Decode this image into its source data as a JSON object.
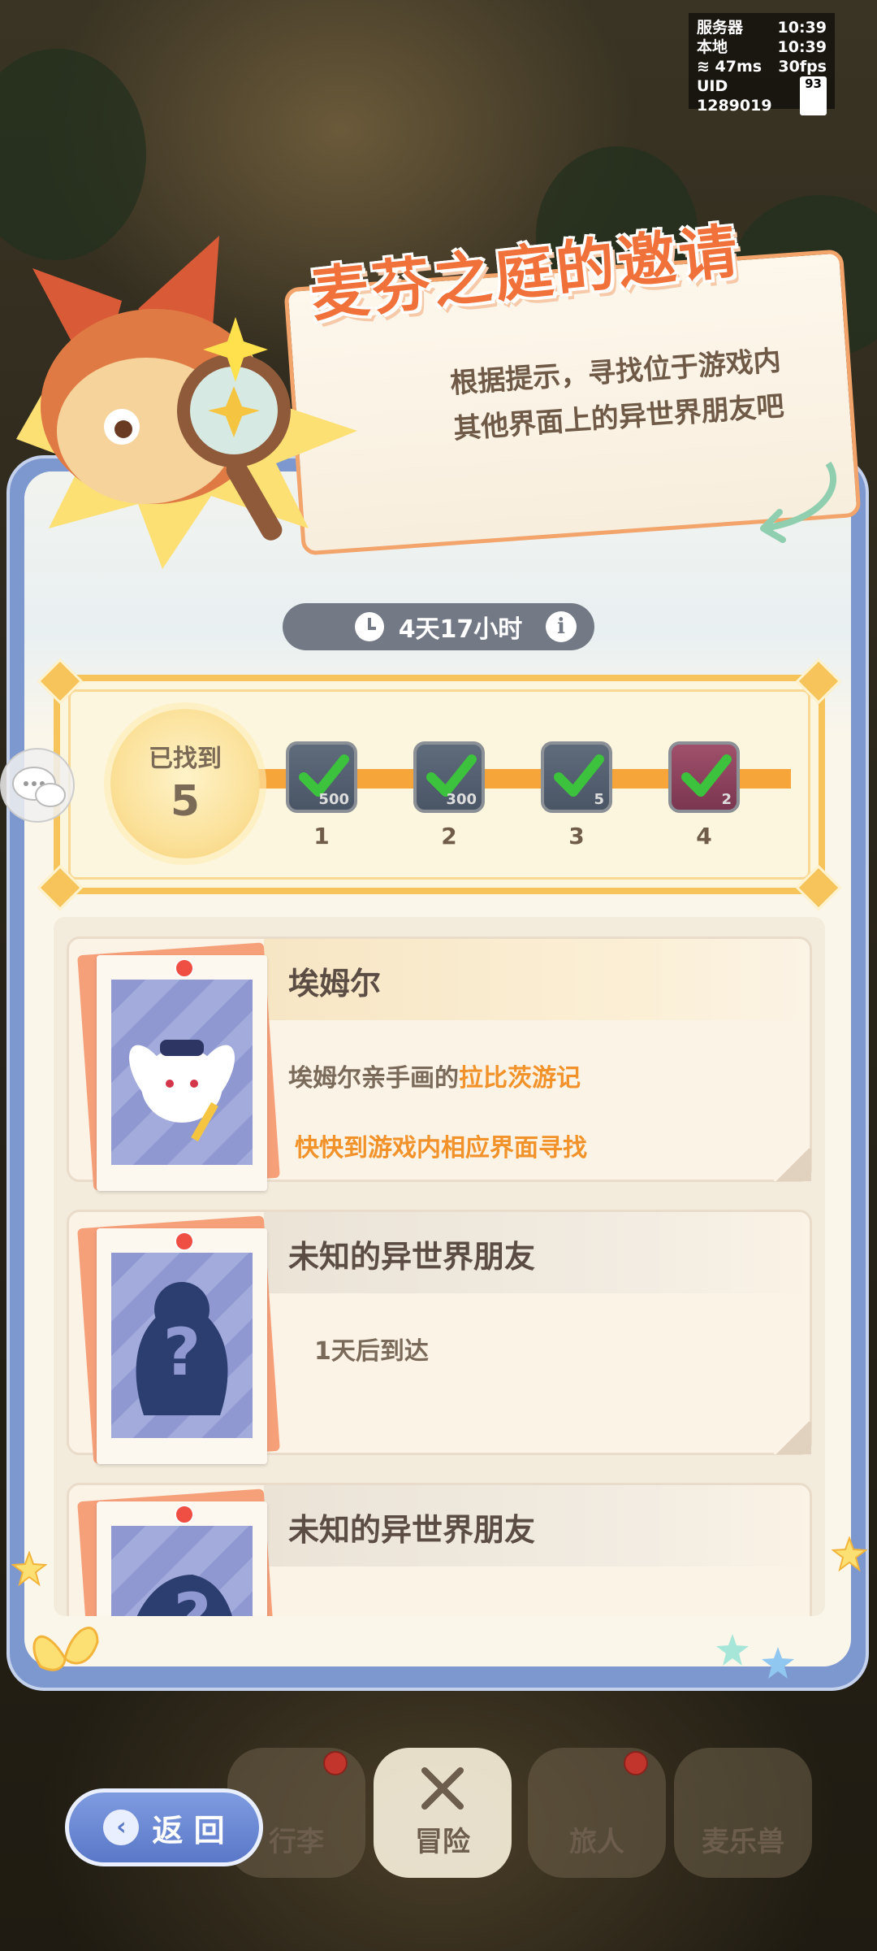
{
  "status": {
    "server_label": "服务器",
    "server_time": "10:39",
    "local_label": "本地",
    "local_time": "10:39",
    "ping": "47ms",
    "fps": "30fps",
    "uid": "UID 1289019",
    "battery": "93"
  },
  "event": {
    "title": "麦芬之庭的邀请",
    "subtitle_line1": "根据提示，寻找位于游戏内",
    "subtitle_line2": "其他界面上的异世界朋友吧",
    "timer": "4天17小时"
  },
  "progress": {
    "found_label": "已找到",
    "found_count": "5",
    "rewards": [
      {
        "step": "1",
        "qty": "500",
        "claimed": true
      },
      {
        "step": "2",
        "qty": "300",
        "claimed": true
      },
      {
        "step": "3",
        "qty": "5",
        "claimed": true
      },
      {
        "step": "4",
        "qty": "2",
        "claimed": true
      }
    ]
  },
  "friends": [
    {
      "name": "埃姆尔",
      "desc_prefix": "埃姆尔亲手画的",
      "desc_highlight": "拉比茨游记",
      "action": "快快到游戏内相应界面寻找"
    },
    {
      "name": "未知的异世界朋友",
      "eta": "1天后到达"
    },
    {
      "name": "未知的异世界朋友"
    }
  ],
  "nav": {
    "back_label": "返 回",
    "items": [
      {
        "label": "行李"
      },
      {
        "label": "冒险"
      },
      {
        "label": "旅人"
      },
      {
        "label": "麦乐兽"
      }
    ]
  },
  "colors": {
    "accent_orange": "#f2922b",
    "title_orange": "#f1713a",
    "panel_blue": "#7d97cf",
    "check_green": "#3cc23c"
  }
}
